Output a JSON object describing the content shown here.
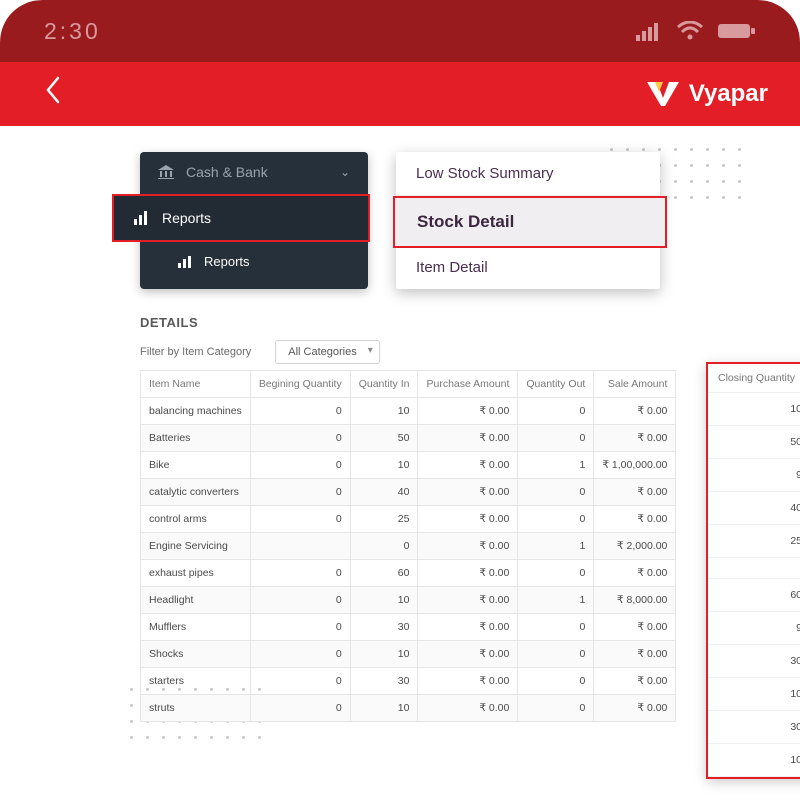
{
  "status": {
    "time": "2:30"
  },
  "logo": {
    "text": "Vyapar"
  },
  "nav": {
    "cash_bank": "Cash & Bank",
    "reports_main": "Reports",
    "reports_sub": "Reports"
  },
  "report_menu": {
    "low_stock": "Low Stock Summary",
    "stock_detail": "Stock Detail",
    "item_detail": "Item Detail"
  },
  "details": {
    "title": "DETAILS",
    "filter_label": "Filter by Item Category",
    "filter_value": "All Categories",
    "columns": {
      "item_name": "Item Name",
      "begin_qty": "Begining Quantity",
      "qty_in": "Quantity In",
      "purchase_amt": "Purchase Amount",
      "qty_out": "Quantity Out",
      "sale_amt": "Sale Amount",
      "closing_qty": "Closing Quantity"
    },
    "rows": [
      {
        "name": "balancing machines",
        "bq": "0",
        "qi": "10",
        "pa": "₹ 0.00",
        "qo": "0",
        "sa": "₹ 0.00",
        "cq": "10"
      },
      {
        "name": "Batteries",
        "bq": "0",
        "qi": "50",
        "pa": "₹ 0.00",
        "qo": "0",
        "sa": "₹ 0.00",
        "cq": "50"
      },
      {
        "name": "Bike",
        "bq": "0",
        "qi": "10",
        "pa": "₹ 0.00",
        "qo": "1",
        "sa": "₹ 1,00,000.00",
        "cq": "9"
      },
      {
        "name": "catalytic converters",
        "bq": "0",
        "qi": "40",
        "pa": "₹ 0.00",
        "qo": "0",
        "sa": "₹ 0.00",
        "cq": "40"
      },
      {
        "name": "control arms",
        "bq": "0",
        "qi": "25",
        "pa": "₹ 0.00",
        "qo": "0",
        "sa": "₹ 0.00",
        "cq": "25"
      },
      {
        "name": "Engine Servicing",
        "bq": "",
        "qi": "0",
        "pa": "₹ 0.00",
        "qo": "1",
        "sa": "₹ 2,000.00",
        "cq": ""
      },
      {
        "name": "exhaust pipes",
        "bq": "0",
        "qi": "60",
        "pa": "₹ 0.00",
        "qo": "0",
        "sa": "₹ 0.00",
        "cq": "60"
      },
      {
        "name": "Headlight",
        "bq": "0",
        "qi": "10",
        "pa": "₹ 0.00",
        "qo": "1",
        "sa": "₹ 8,000.00",
        "cq": "9"
      },
      {
        "name": "Mufflers",
        "bq": "0",
        "qi": "30",
        "pa": "₹ 0.00",
        "qo": "0",
        "sa": "₹ 0.00",
        "cq": "30"
      },
      {
        "name": "Shocks",
        "bq": "0",
        "qi": "10",
        "pa": "₹ 0.00",
        "qo": "0",
        "sa": "₹ 0.00",
        "cq": "10"
      },
      {
        "name": "starters",
        "bq": "0",
        "qi": "30",
        "pa": "₹ 0.00",
        "qo": "0",
        "sa": "₹ 0.00",
        "cq": "30"
      },
      {
        "name": "struts",
        "bq": "0",
        "qi": "10",
        "pa": "₹ 0.00",
        "qo": "0",
        "sa": "₹ 0.00",
        "cq": "10"
      }
    ]
  }
}
